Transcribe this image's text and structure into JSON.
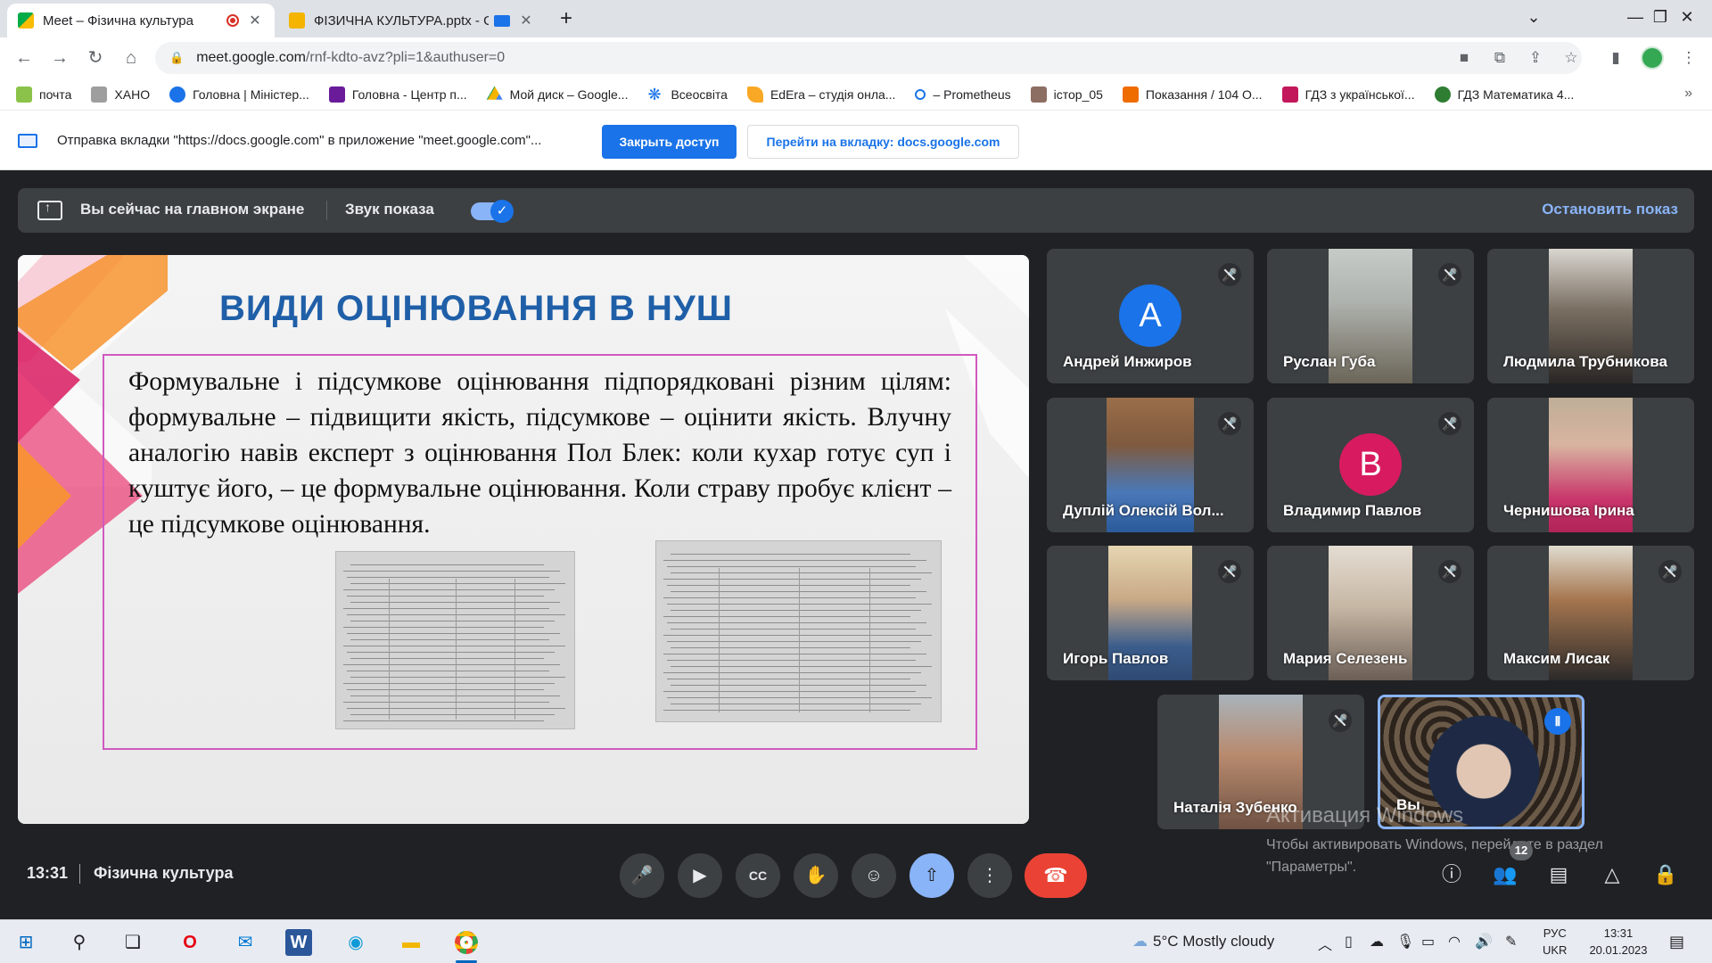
{
  "browser": {
    "tabs": [
      {
        "title": "Meet – Фізична культура",
        "color": "#00ac47"
      },
      {
        "title": "ФІЗИЧНА КУЛЬТУРА.pptx - G",
        "color": "#f4b400"
      }
    ],
    "url_host": "meet.google.com",
    "url_path": "/rnf-kdto-avz?pli=1&authuser=0",
    "bookmarks": [
      "почта",
      "ХАНО",
      "Головна | Міністер...",
      "Головна - Центр п...",
      "Мой диск – Google...",
      "Всеосвіта",
      "EdEra – студія онла...",
      "– Prometheus",
      "істор_05",
      "Показання / 104 О...",
      "ГДЗ з української...",
      "ГДЗ Математика 4..."
    ]
  },
  "sharing_bar": {
    "message": "Отправка вкладки \"https://docs.google.com\" в приложение \"meet.google.com\"...",
    "close_access": "Закрыть доступ",
    "go_to_tab": "Перейти на вкладку: docs.google.com"
  },
  "presentation_bar": {
    "status": "Вы сейчас на главном экране",
    "audio_label": "Звук показа",
    "stop": "Остановить показ"
  },
  "slide": {
    "title": "ВИДИ  ОЦІНЮВАННЯ  В  НУШ",
    "body": "Формувальне і підсумкове оцінювання підпорядковані різним цілям: формувальне – підвищити якість, підсумкове – оцінити якість. Влучну аналогію  навів експерт з оцінювання Пол Блек: коли кухар готує суп і куштує його, – це формувальне оцінювання. Коли страву пробує клієнт – це підсумкове оцінювання."
  },
  "participants": [
    {
      "name": "Андрей Инжиров",
      "initial": "А",
      "color": "#1a73e8"
    },
    {
      "name": "Руслан Губа"
    },
    {
      "name": "Людмила Трубникова"
    },
    {
      "name": "Дуплій Олексій Вол..."
    },
    {
      "name": "Владимир Павлов",
      "initial": "В",
      "color": "#d81b60"
    },
    {
      "name": "Чернишова Ірина"
    },
    {
      "name": "Игорь Павлов"
    },
    {
      "name": "Мария Селезень"
    },
    {
      "name": "Максим Лисак"
    },
    {
      "name": "Наталія Зубенко"
    },
    {
      "name": "Вы"
    }
  ],
  "watermark": {
    "title": "Активация Windows",
    "text": "Чтобы активировать Windows, перейдите в раздел \"Параметры\"."
  },
  "controls": {
    "time": "13:31",
    "meeting_name": "Фізична культура",
    "participant_count": "12"
  },
  "taskbar": {
    "weather": "5°C  Mostly cloudy",
    "lang_top": "РУС",
    "lang_bottom": "UKR",
    "time": "13:31",
    "date": "20.01.2023"
  }
}
